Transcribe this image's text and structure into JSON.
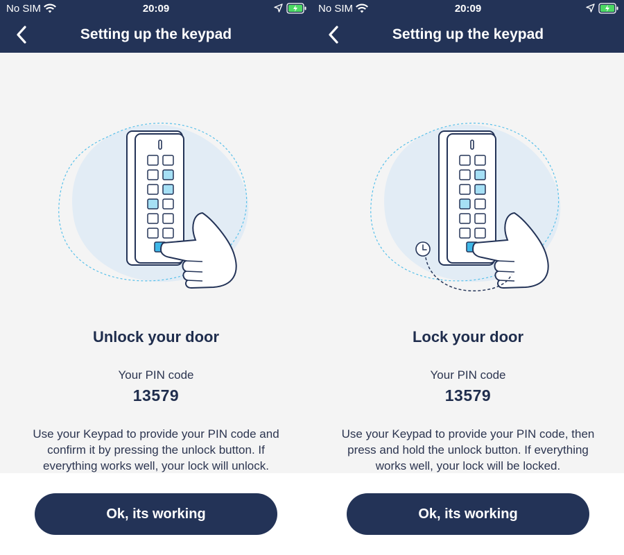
{
  "status_bar": {
    "carrier": "No SIM",
    "time": "20:09"
  },
  "screens": [
    {
      "nav_title": "Setting up the keypad",
      "title": "Unlock your door",
      "pin_label": "Your PIN code",
      "pin_value": "13579",
      "description": "Use your Keypad to provide your PIN code and confirm it by pressing the unlock button. If everything works well, your lock will unlock.",
      "button_label": "Ok, its working"
    },
    {
      "nav_title": "Setting up the keypad",
      "title": "Lock your door",
      "pin_label": "Your PIN code",
      "pin_value": "13579",
      "description": "Use your Keypad to provide your PIN code, then press and hold the unlock button. If everything works well, your lock will be locked.",
      "button_label": "Ok, its working"
    }
  ],
  "colors": {
    "header": "#233357",
    "accent": "#3fb8e8",
    "background": "#f4f4f4",
    "blob": "#e2ecf5"
  },
  "icons": [
    "wifi-icon",
    "location-icon",
    "battery-icon",
    "back-arrow-icon",
    "clock-icon"
  ]
}
